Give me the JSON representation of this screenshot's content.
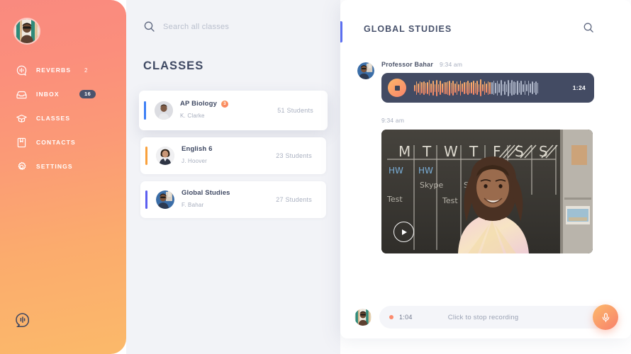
{
  "sidebar": {
    "avatar_name": "user-avatar",
    "items": [
      {
        "id": "reverbs",
        "label": "REVERBS",
        "icon": "reverb-icon",
        "count": "2"
      },
      {
        "id": "inbox",
        "label": "INBOX",
        "icon": "inbox-icon",
        "badge": "16"
      },
      {
        "id": "classes",
        "label": "CLASSES",
        "icon": "graduation-icon"
      },
      {
        "id": "contacts",
        "label": "CONTACTS",
        "icon": "contacts-icon"
      },
      {
        "id": "settings",
        "label": "SETTINGS",
        "icon": "gear-icon"
      }
    ],
    "logo": "reverb-logo-icon"
  },
  "search": {
    "placeholder": "Search all classes",
    "value": "",
    "icon": "search-icon"
  },
  "classes_panel": {
    "heading": "CLASSES",
    "add_button_label": "+",
    "items": [
      {
        "name": "AP Biology",
        "teacher": "K. Clarke",
        "students": "51 Students",
        "accent": "#3d7ff5",
        "active": true,
        "badge": "3"
      },
      {
        "name": "English 6",
        "teacher": "J. Hoover",
        "students": "23 Students",
        "accent": "#f9a13c",
        "active": false,
        "badge": ""
      },
      {
        "name": "Global Studies",
        "teacher": "F. Bahar",
        "students": "27 Students",
        "accent": "#5c5ff0",
        "active": false,
        "badge": ""
      }
    ]
  },
  "conversation": {
    "title": "GLOBAL STUDIES",
    "accent": "#5c6ff0",
    "search_icon": "search-icon",
    "settings_icon": "gear-icon",
    "messages": [
      {
        "type": "audio",
        "author": "Professor Bahar",
        "time": "9:34 am",
        "duration": "1:24",
        "progress": 0.62,
        "played_color": "#f99a6e",
        "unplayed_color": "#aeb6c8",
        "player_bg": "#434b63",
        "button": "stop-button"
      },
      {
        "type": "video",
        "time": "9:34 am",
        "play_label": "play-button",
        "board_days": [
          "M",
          "T",
          "W",
          "T",
          "F",
          "S",
          "S"
        ],
        "board_notes": [
          "HW",
          "HW",
          "Skype",
          "Skype",
          "Test",
          "Test"
        ]
      }
    ],
    "recorder": {
      "elapsed": "1:04",
      "hint": "Click to stop recording",
      "dot_color": "#fb8b6e",
      "mic_icon": "microphone-icon",
      "avatar": "user-avatar"
    }
  },
  "colors": {
    "sidebar_start": "#f98a7f",
    "sidebar_end": "#fbb96a",
    "app_bg": "#f2f3f7",
    "text_dark": "#3f4963",
    "text_muted": "#a9b0c0",
    "fab": "#4e5872"
  }
}
